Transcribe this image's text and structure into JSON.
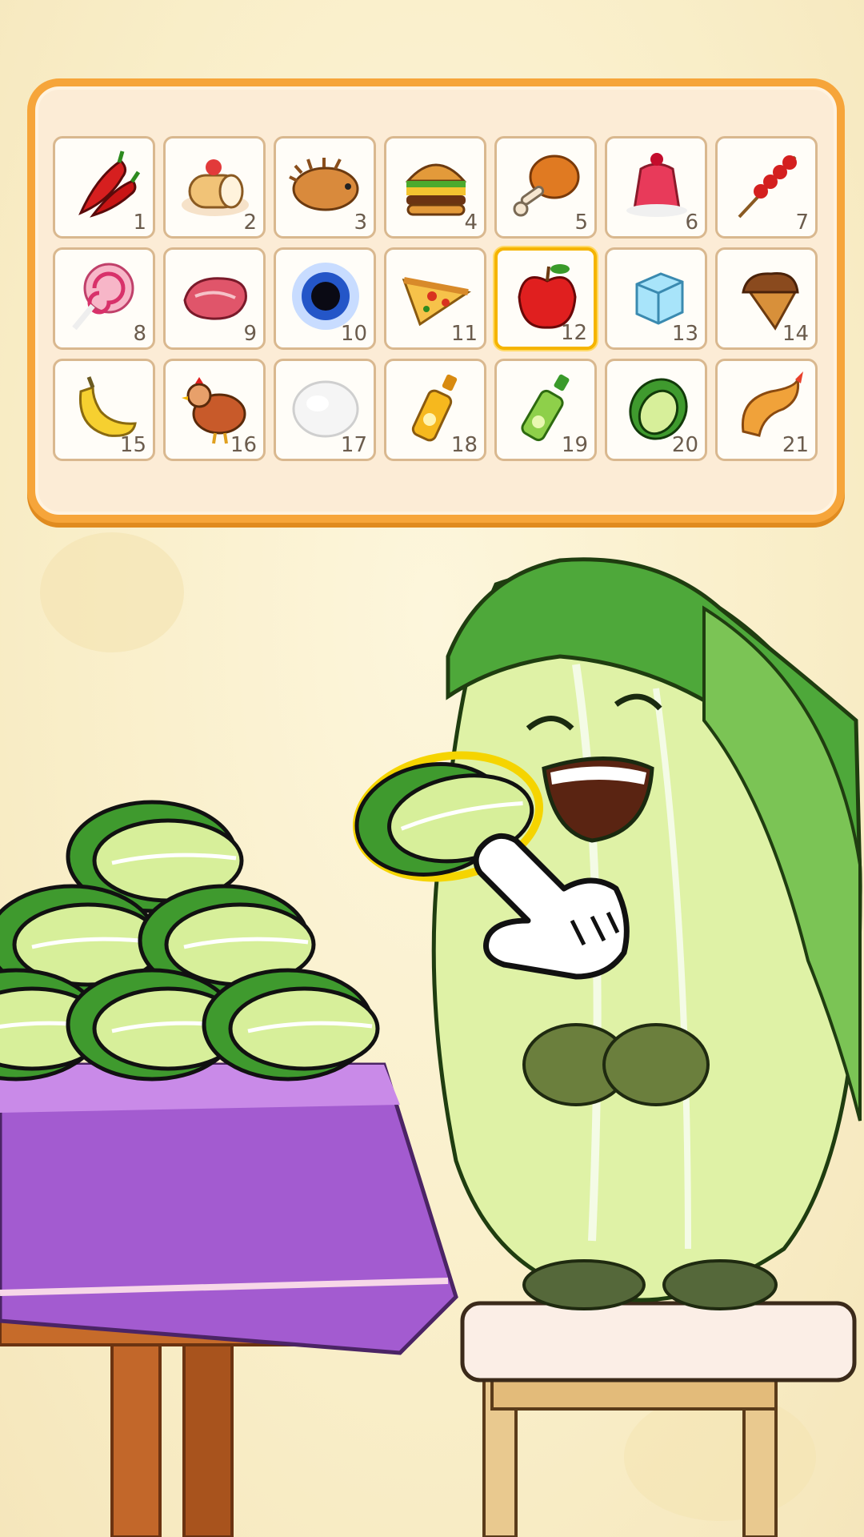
{
  "food_grid": {
    "items": [
      {
        "number": "1",
        "icon": "chili-pepper-icon"
      },
      {
        "number": "2",
        "icon": "swiss-roll-cake-icon"
      },
      {
        "number": "3",
        "icon": "hedgehog-icon"
      },
      {
        "number": "4",
        "icon": "burger-icon"
      },
      {
        "number": "5",
        "icon": "fried-chicken-leg-icon"
      },
      {
        "number": "6",
        "icon": "jelly-pudding-icon"
      },
      {
        "number": "7",
        "icon": "candied-skewer-icon"
      },
      {
        "number": "8",
        "icon": "lollipop-icon"
      },
      {
        "number": "9",
        "icon": "raw-steak-icon"
      },
      {
        "number": "10",
        "icon": "black-hole-icon"
      },
      {
        "number": "11",
        "icon": "pizza-slice-icon"
      },
      {
        "number": "12",
        "icon": "apple-icon",
        "selected": true
      },
      {
        "number": "13",
        "icon": "ice-cube-icon"
      },
      {
        "number": "14",
        "icon": "ice-cream-cone-icon"
      },
      {
        "number": "15",
        "icon": "banana-icon"
      },
      {
        "number": "16",
        "icon": "chicken-icon"
      },
      {
        "number": "17",
        "icon": "cotton-fluff-icon"
      },
      {
        "number": "18",
        "icon": "orange-juice-bottle-icon"
      },
      {
        "number": "19",
        "icon": "green-drink-bottle-icon"
      },
      {
        "number": "20",
        "icon": "cabbage-icon"
      },
      {
        "number": "21",
        "icon": "fried-shrimp-icon"
      }
    ]
  },
  "scene": {
    "character": "napa-cabbage-character",
    "held_item": "cabbage",
    "hint": "tap-hand-pointer",
    "table_pile": "cabbage-pile",
    "colors": {
      "panel_border": "#f6a53a",
      "selected_border": "#f5b400",
      "tablecloth": "#a35bd0"
    }
  }
}
